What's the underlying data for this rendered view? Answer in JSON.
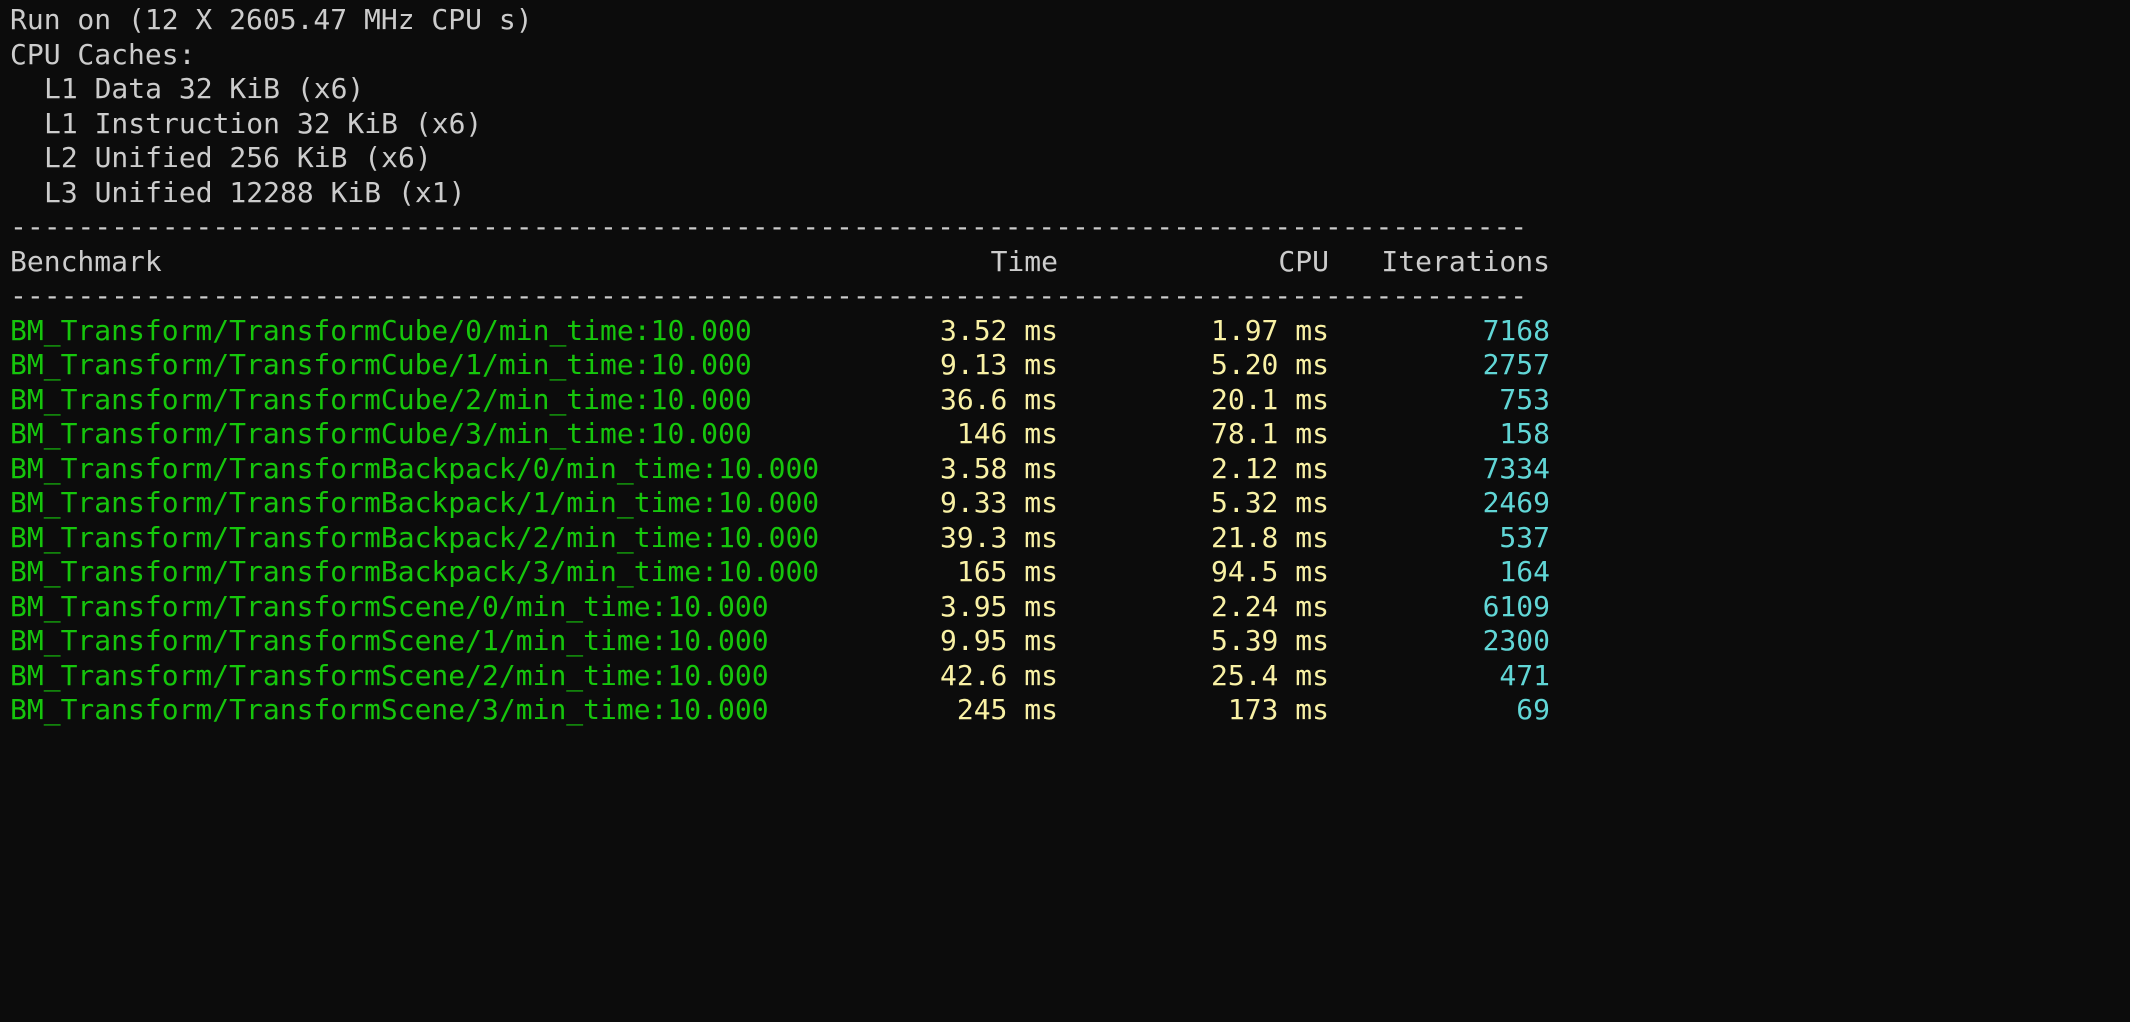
{
  "header_info": {
    "run_on": "Run on (12 X 2605.47 MHz CPU s)",
    "cpu_caches_label": "CPU Caches:",
    "caches": [
      "L1 Data 32 KiB (x6)",
      "L1 Instruction 32 KiB (x6)",
      "L2 Unified 256 KiB (x6)",
      "L3 Unified 12288 KiB (x1)"
    ]
  },
  "separator": "------------------------------------------------------------------------------------------",
  "table": {
    "headers": {
      "benchmark": "Benchmark",
      "time": "Time",
      "cpu": "CPU",
      "iterations": "Iterations"
    },
    "rows": [
      {
        "name": "BM_Transform/TransformCube/0/min_time:10.000",
        "time": "3.52 ms",
        "cpu": "1.97 ms",
        "iterations": "7168"
      },
      {
        "name": "BM_Transform/TransformCube/1/min_time:10.000",
        "time": "9.13 ms",
        "cpu": "5.20 ms",
        "iterations": "2757"
      },
      {
        "name": "BM_Transform/TransformCube/2/min_time:10.000",
        "time": "36.6 ms",
        "cpu": "20.1 ms",
        "iterations": "753"
      },
      {
        "name": "BM_Transform/TransformCube/3/min_time:10.000",
        "time": "146 ms",
        "cpu": "78.1 ms",
        "iterations": "158"
      },
      {
        "name": "BM_Transform/TransformBackpack/0/min_time:10.000",
        "time": "3.58 ms",
        "cpu": "2.12 ms",
        "iterations": "7334"
      },
      {
        "name": "BM_Transform/TransformBackpack/1/min_time:10.000",
        "time": "9.33 ms",
        "cpu": "5.32 ms",
        "iterations": "2469"
      },
      {
        "name": "BM_Transform/TransformBackpack/2/min_time:10.000",
        "time": "39.3 ms",
        "cpu": "21.8 ms",
        "iterations": "537"
      },
      {
        "name": "BM_Transform/TransformBackpack/3/min_time:10.000",
        "time": "165 ms",
        "cpu": "94.5 ms",
        "iterations": "164"
      },
      {
        "name": "BM_Transform/TransformScene/0/min_time:10.000",
        "time": "3.95 ms",
        "cpu": "2.24 ms",
        "iterations": "6109"
      },
      {
        "name": "BM_Transform/TransformScene/1/min_time:10.000",
        "time": "9.95 ms",
        "cpu": "5.39 ms",
        "iterations": "2300"
      },
      {
        "name": "BM_Transform/TransformScene/2/min_time:10.000",
        "time": "42.6 ms",
        "cpu": "25.4 ms",
        "iterations": "471"
      },
      {
        "name": "BM_Transform/TransformScene/3/min_time:10.000",
        "time": "245 ms",
        "cpu": "173 ms",
        "iterations": "69"
      }
    ]
  },
  "colors": {
    "background": "#0c0c0c",
    "default_text": "#cccccc",
    "benchmark_name": "#16c60c",
    "time_values": "#f9f1a5",
    "iterations": "#61d6d6"
  }
}
